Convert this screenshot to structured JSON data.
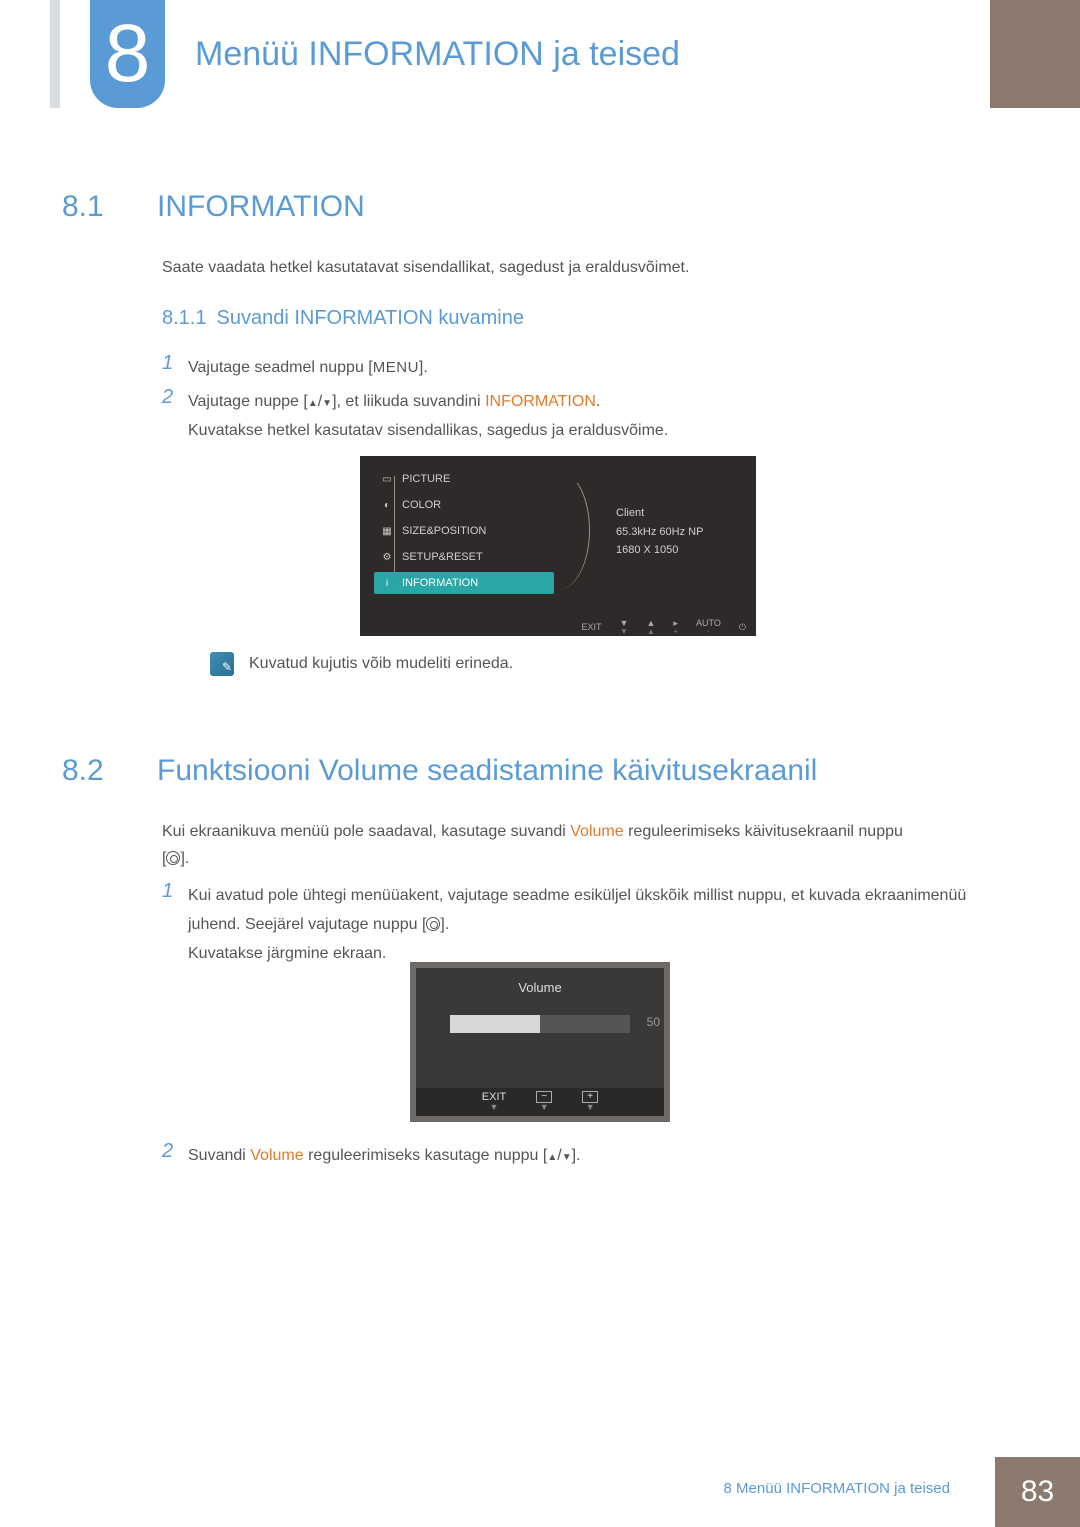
{
  "chapter": {
    "number": "8",
    "title": "Menüü INFORMATION ja teised"
  },
  "s81": {
    "num": "8.1",
    "title": "INFORMATION",
    "intro": "Saate vaadata hetkel kasutatavat sisendallikat, sagedust ja eraldusvõimet.",
    "sub": {
      "num": "8.1.1",
      "title": "Suvandi INFORMATION kuvamine",
      "step1_pre": "Vajutage seadmel nuppu [",
      "step1_key": "MENU",
      "step1_post": "].",
      "step2_pre": "Vajutage nuppe [",
      "step2_mid": "], et liikuda suvandini ",
      "step2_kw": "INFORMATION",
      "step2_post": ".",
      "step2_line2": "Kuvatakse hetkel kasutatav sisendallikas, sagedus ja eraldusvõime.",
      "note": "Kuvatud kujutis võib mudeliti erineda."
    }
  },
  "osd1": {
    "menu": [
      "PICTURE",
      "COLOR",
      "SIZE&POSITION",
      "SETUP&RESET",
      "INFORMATION"
    ],
    "info": {
      "client": "Client",
      "freq": "65.3kHz 60Hz NP",
      "res": "1680 X 1050"
    },
    "footer": {
      "exit": "EXIT",
      "auto": "AUTO"
    }
  },
  "s82": {
    "num": "8.2",
    "title": "Funktsiooni Volume seadistamine käivitusekraanil",
    "intro_a": "Kui ekraanikuva menüü pole saadaval, kasutage suvandi ",
    "intro_kw": "Volume",
    "intro_b": " reguleerimiseks käivitusekraanil nuppu",
    "step1": "Kui avatud pole ühtegi menüüakent, vajutage seadme esiküljel ükskõik millist nuppu, et kuvada ekraanimenüü juhend. Seejärel vajutage nuppu [",
    "step1_post": "].",
    "step1_line2": "Kuvatakse järgmine ekraan.",
    "step2_a": "Suvandi ",
    "step2_kw": "Volume",
    "step2_b": " reguleerimiseks kasutage nuppu [",
    "step2_c": "]."
  },
  "osd2": {
    "title": "Volume",
    "value": "50",
    "exit": "EXIT"
  },
  "footer": {
    "chapter": "8 Menüü INFORMATION ja teised",
    "page": "83"
  }
}
